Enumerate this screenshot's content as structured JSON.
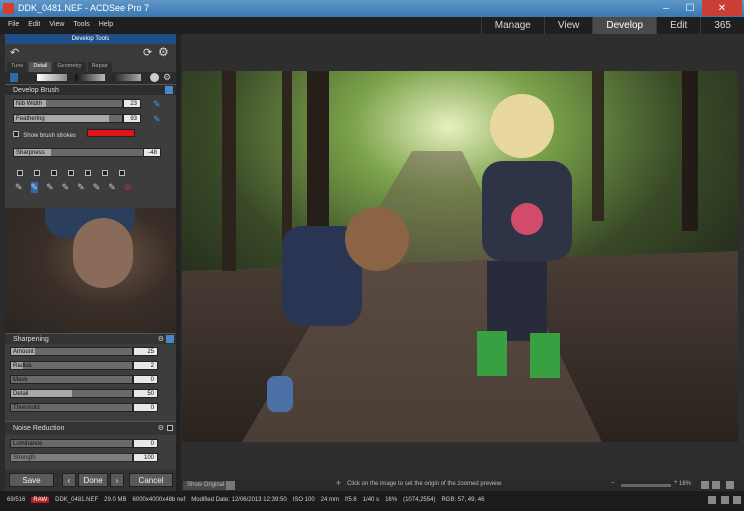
{
  "window": {
    "title": "DDK_0481.NEF - ACDSee Pro 7"
  },
  "menu": [
    "File",
    "Edit",
    "View",
    "Tools",
    "Help"
  ],
  "modes": [
    "Manage",
    "View",
    "Develop",
    "Edit",
    "365"
  ],
  "panel": {
    "header": "Develop Tools",
    "tabs": [
      "Tune",
      "Detail",
      "Geometry",
      "Repair"
    ],
    "brush": {
      "title": "Develop Brush",
      "nib_label": "Nib Width",
      "nib_value": "23",
      "feather_label": "Feathering",
      "feather_value": "93",
      "show_strokes": "Show brush strokes",
      "sharpness_label": "Sharpness",
      "sharpness_value": "-48"
    },
    "sharpening": {
      "title": "Sharpening",
      "rows": [
        {
          "label": "Amount",
          "value": "25"
        },
        {
          "label": "Radius",
          "value": "2"
        },
        {
          "label": "Mask",
          "value": "0"
        },
        {
          "label": "Detail",
          "value": "50"
        },
        {
          "label": "Threshold",
          "value": "0"
        }
      ]
    },
    "noise": {
      "title": "Noise Reduction",
      "rows": [
        {
          "label": "Luminance",
          "value": "0"
        },
        {
          "label": "Strength",
          "value": "100"
        }
      ]
    },
    "buttons": {
      "save": "Save",
      "done": "Done",
      "cancel": "Cancel",
      "prev": "‹",
      "next": "›"
    }
  },
  "infobar": {
    "show_original": "Show Original",
    "hint": "Click on the image to set the origin of the zoomed preview.",
    "zoom": "16%"
  },
  "status": {
    "count": "69/516",
    "filename": "DDK_0481.NEF",
    "size": "29.0 MB",
    "dims": "6000x4000x48b nef",
    "modified": "Modified Date: 12/06/2013 12:39:50",
    "iso": "ISO 100",
    "focal": "24 mm",
    "aperture": "f/5.6",
    "shutter": "1/40 s",
    "zoom": "16%",
    "coords": "(1074,2554)",
    "rgb": "RGB: 57, 49, 46"
  }
}
